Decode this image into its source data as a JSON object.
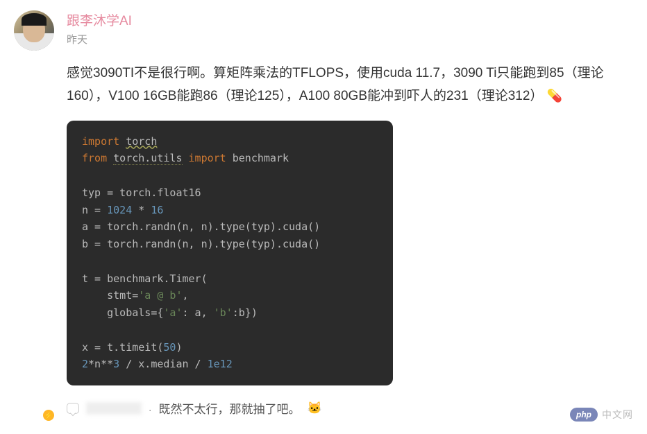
{
  "author": {
    "name": "跟李沐学AI",
    "timestamp": "昨天"
  },
  "post": {
    "text_line1": "感觉3090TI不是很行啊。算矩阵乘法的TFLOPS，使用cuda 11.7，3090 Ti只能跑到85（理论160），V100 16GB能跑86（理论125），A100 80GB能冲到吓人的231（理论312）",
    "emoji": "💊"
  },
  "code": {
    "l1_import": "import",
    "l1_mod": "torch",
    "l2_from": "from",
    "l2_mod": "torch.utils",
    "l2_import": "import",
    "l2_name": "benchmark",
    "l4": "typ = torch.float16",
    "l5_a": "n = ",
    "l5_b": "1024",
    "l5_c": " * ",
    "l5_d": "16",
    "l6": "a = torch.randn(n, n).type(typ).cuda()",
    "l7": "b = torch.randn(n, n).type(typ).cuda()",
    "l9": "t = benchmark.Timer(",
    "l10_a": "    stmt=",
    "l10_b": "'a @ b'",
    "l10_c": ",",
    "l11_a": "    globals={",
    "l11_b": "'a'",
    "l11_c": ": a, ",
    "l11_d": "'b'",
    "l11_e": ":b})",
    "l13_a": "x = t.timeit(",
    "l13_b": "50",
    "l13_c": ")",
    "l14_a": "2",
    "l14_b": "*n**",
    "l14_c": "3",
    "l14_d": " / x.median / ",
    "l14_e": "1e12"
  },
  "comment": {
    "text": "既然不太行，那就抽了吧。",
    "emoji": "🐱"
  },
  "watermark": {
    "logo": "php",
    "text": "中文网"
  }
}
